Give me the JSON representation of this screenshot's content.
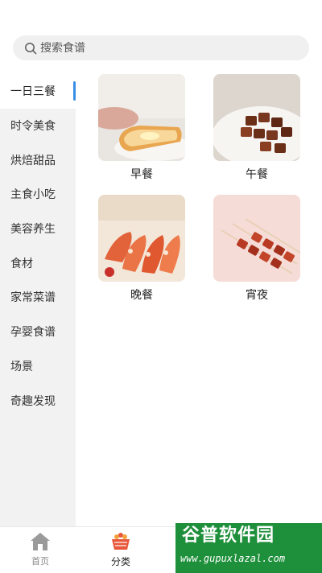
{
  "search": {
    "placeholder": "搜索食谱"
  },
  "sidebar": {
    "items": [
      {
        "label": "一日三餐",
        "active": true
      },
      {
        "label": "时令美食"
      },
      {
        "label": "烘焙甜品"
      },
      {
        "label": "主食小吃"
      },
      {
        "label": "美容养生"
      },
      {
        "label": "食材"
      },
      {
        "label": "家常菜谱"
      },
      {
        "label": "孕婴食谱"
      },
      {
        "label": "场景"
      },
      {
        "label": "奇趣发现"
      }
    ]
  },
  "categories": [
    {
      "label": "早餐",
      "image": "toast-breakfast"
    },
    {
      "label": "午餐",
      "image": "braised-pork-lunch"
    },
    {
      "label": "晚餐",
      "image": "shrimp-dinner"
    },
    {
      "label": "宵夜",
      "image": "skewers-night-snack"
    }
  ],
  "tabbar": {
    "home_label": "首页",
    "category_label": "分类"
  },
  "watermark": {
    "title": "谷普软件园",
    "url": "www.gupuxlazal.com"
  },
  "colors": {
    "accent": "#3a8ee6",
    "sidebar_bg": "#f2f2f2",
    "watermark_bg": "#1e8f3a"
  }
}
